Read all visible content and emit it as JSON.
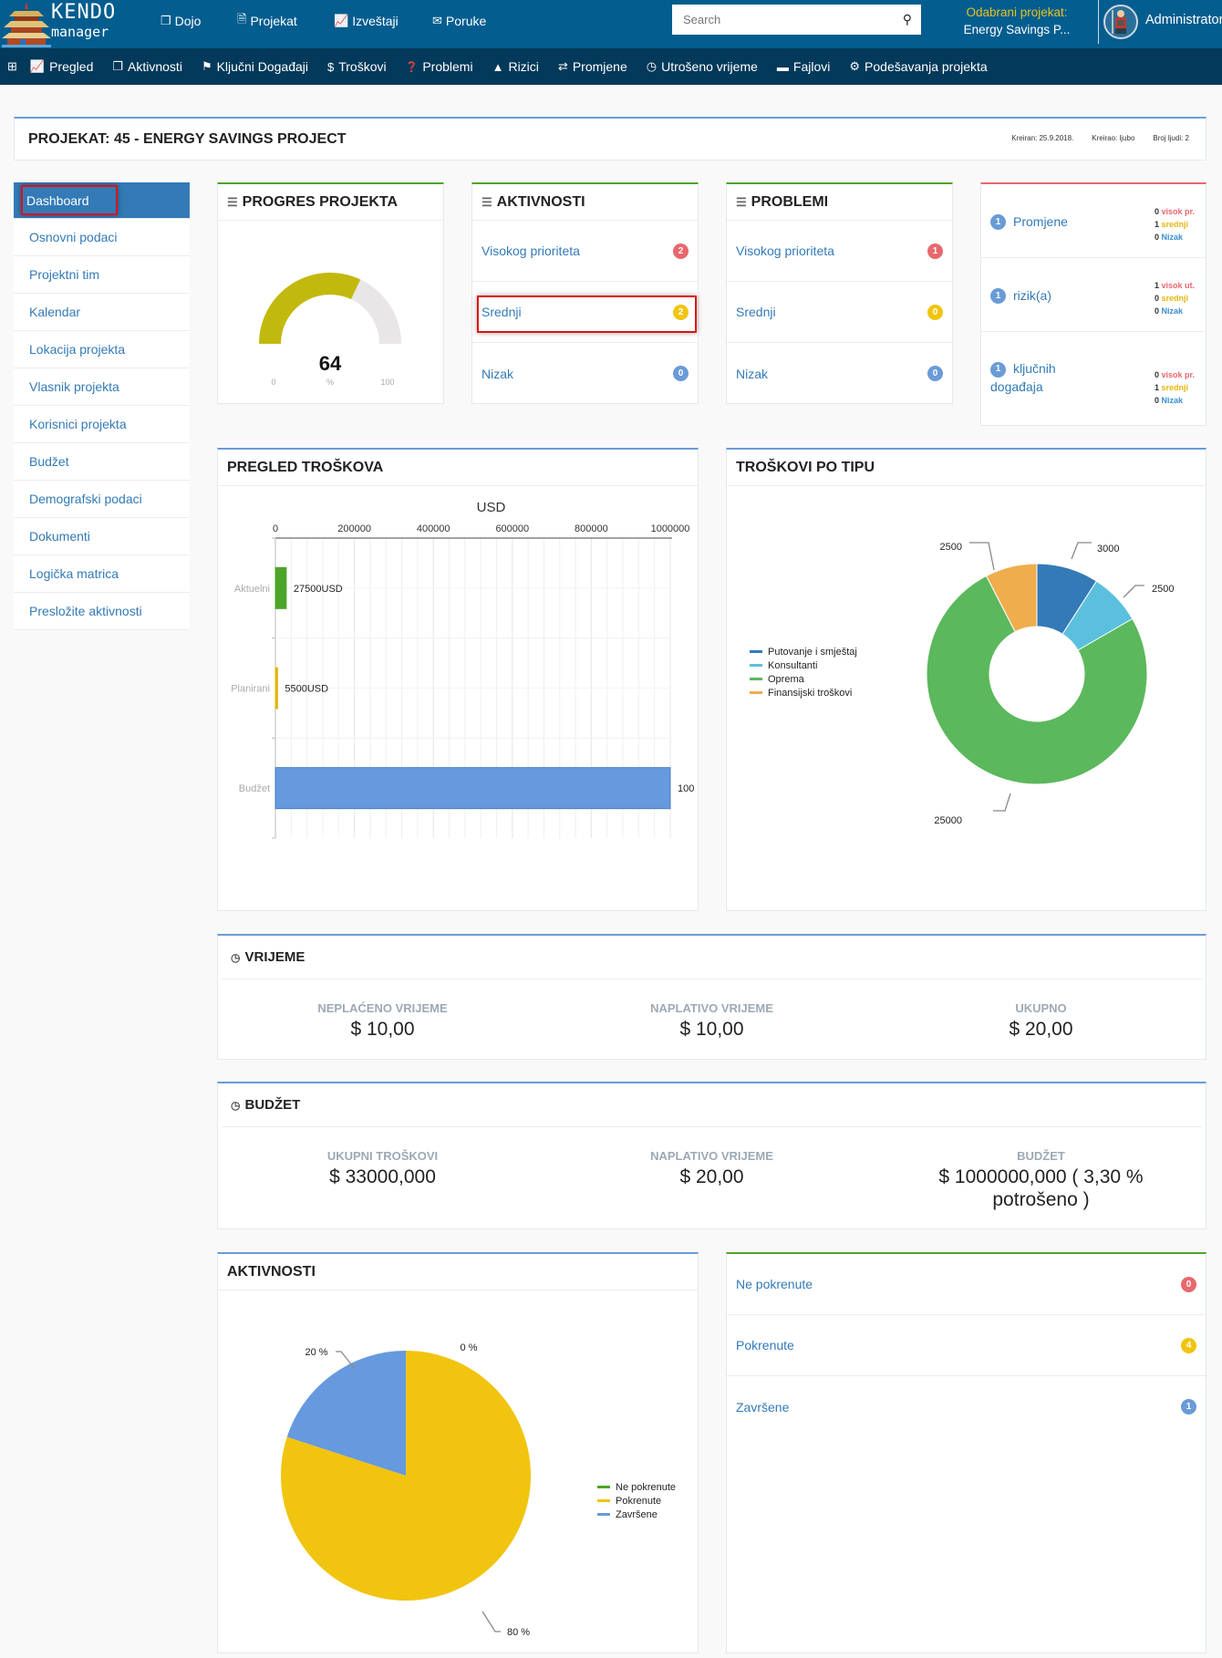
{
  "app": {
    "logo_top": "KENDO",
    "logo_bottom": "manager"
  },
  "topnav": [
    {
      "icon": "copy-icon",
      "glyph": "❐",
      "label": "Dojo"
    },
    {
      "icon": "file-icon",
      "glyph": "🗎",
      "label": "Projekat"
    },
    {
      "icon": "chart-line-icon",
      "glyph": "📈",
      "label": "Izveštaji"
    },
    {
      "icon": "envelope-icon",
      "glyph": "✉",
      "label": "Poruke"
    }
  ],
  "search": {
    "placeholder": "Search"
  },
  "selected_project": {
    "label": "Odabrani projekat:",
    "value": "Energy Savings P..."
  },
  "user": {
    "name": "Administrator"
  },
  "subnav": [
    {
      "icon": "plus-square-icon",
      "glyph": "⊞",
      "label": ""
    },
    {
      "icon": "chart-line-icon",
      "glyph": "📈",
      "label": "Pregled"
    },
    {
      "icon": "copy-icon",
      "glyph": "❐",
      "label": "Aktivnosti"
    },
    {
      "icon": "flag-icon",
      "glyph": "⚑",
      "label": "Ključni Događaji"
    },
    {
      "icon": "dollar-icon",
      "glyph": "$",
      "label": "Troškovi"
    },
    {
      "icon": "question-circle-icon",
      "glyph": "❓",
      "label": "Problemi"
    },
    {
      "icon": "warning-icon",
      "glyph": "▲",
      "label": "Rizici"
    },
    {
      "icon": "exchange-icon",
      "glyph": "⇄",
      "label": "Promjene"
    },
    {
      "icon": "clock-icon",
      "glyph": "◷",
      "label": "Utrošeno vrijeme"
    },
    {
      "icon": "folder-icon",
      "glyph": "▬",
      "label": "Fajlovi"
    },
    {
      "icon": "cogs-icon",
      "glyph": "⚙",
      "label": "Podešavanja projekta"
    }
  ],
  "project": {
    "title": "PROJEKAT: 45 - ENERGY SAVINGS PROJECT",
    "created": "Kreiran: 25.9.2018.",
    "created_by": "Kreirao: ljubo",
    "people": "Broj ljudi: 2"
  },
  "sidebar": [
    {
      "label": "Dashboard",
      "active": true
    },
    {
      "label": "Osnovni podaci"
    },
    {
      "label": "Projektni tim"
    },
    {
      "label": "Kalendar"
    },
    {
      "label": "Lokacija projekta"
    },
    {
      "label": "Vlasnik projekta"
    },
    {
      "label": "Korisnici projekta"
    },
    {
      "label": "Budžet"
    },
    {
      "label": "Demografski podaci"
    },
    {
      "label": "Dokumenti"
    },
    {
      "label": "Logička matrica"
    },
    {
      "label": "Presložite aktivnosti"
    }
  ],
  "progress": {
    "title": "PROGRES PROJEKTA",
    "value": 64,
    "min_label": "0",
    "unit_label": "%",
    "max_label": "100",
    "color": "#c2b90e"
  },
  "activities_card": {
    "title": "AKTIVNOSTI",
    "rows": [
      {
        "label": "Visokog prioriteta",
        "count": "2",
        "color": "red"
      },
      {
        "label": "Srednji",
        "count": "2",
        "color": "yellow"
      },
      {
        "label": "Nizak",
        "count": "0",
        "color": "blue"
      }
    ]
  },
  "problems_card": {
    "title": "PROBLEMI",
    "rows": [
      {
        "label": "Visokog prioriteta",
        "count": "1",
        "color": "red"
      },
      {
        "label": "Srednji",
        "count": "0",
        "color": "yellow"
      },
      {
        "label": "Nizak",
        "count": "0",
        "color": "blue"
      }
    ]
  },
  "summary_card": {
    "rows": [
      {
        "count": "1",
        "label": "Promjene",
        "label2": "",
        "c1": "0",
        "l1": "visok pr.",
        "c2": "1",
        "l2": "srednji",
        "c3": "0",
        "l3": "Nizak"
      },
      {
        "count": "1",
        "label": "rizik(a)",
        "label2": "",
        "c1": "1",
        "l1": "visok ut.",
        "c2": "0",
        "l2": "srednji",
        "c3": "0",
        "l3": "Nizak"
      },
      {
        "count": "1",
        "label": "ključnih",
        "label2": "događaja",
        "c1": "0",
        "l1": "visok pr.",
        "c2": "1",
        "l2": "srednji",
        "c3": "0",
        "l3": "Nizak"
      }
    ]
  },
  "chart_data": [
    {
      "type": "bar",
      "orientation": "horizontal",
      "title": "PREGLED TROŠKOVA",
      "axis_title": "USD",
      "categories": [
        "Aktuelni",
        "Planirani",
        "Budžet"
      ],
      "values": [
        27500,
        5500,
        1000000
      ],
      "data_labels": [
        "27500USD",
        "5500USD",
        "100"
      ],
      "colors": [
        "#4ca42a",
        "#e5b50f",
        "#6699dd"
      ],
      "xlim": [
        0,
        1000000
      ],
      "ticks": [
        "0",
        "200000",
        "400000",
        "600000",
        "800000",
        "1000000"
      ],
      "grid": true
    },
    {
      "type": "pie",
      "donut": true,
      "title": "TROŠKOVI PO TIPU",
      "legend": "left",
      "labels": [
        "Putovanje i smještaj",
        "Konsultanti",
        "Oprema",
        "Finansijski troškovi"
      ],
      "values": [
        3000,
        2500,
        25000,
        2500
      ],
      "colors": [
        "#337ab7",
        "#5bc0de",
        "#5cb85c",
        "#f0ad4e"
      ]
    },
    {
      "type": "pie",
      "title": "AKTIVNOSTI",
      "legend": "right",
      "labels": [
        "Ne pokrenute",
        "Pokrenute",
        "Završene"
      ],
      "values": [
        0,
        80,
        20
      ],
      "data_labels": [
        "0 %",
        "80 %",
        "20 %"
      ],
      "colors": [
        "#4ca42a",
        "#f1c40f",
        "#6699dd"
      ]
    }
  ],
  "time_card": {
    "title": "VRIJEME",
    "stats": [
      {
        "label": "NEPLAĆENO VRIJEME",
        "value": "$ 10,00"
      },
      {
        "label": "NAPLATIVO VRIJEME",
        "value": "$ 10,00"
      },
      {
        "label": "UKUPNO",
        "value": "$ 20,00"
      }
    ]
  },
  "budget_card": {
    "title": "BUDŽET",
    "stats": [
      {
        "label": "UKUPNI TROŠKOVI",
        "value": "$ 33000,000"
      },
      {
        "label": "NAPLATIVO VRIJEME",
        "value": "$ 20,00"
      },
      {
        "label": "BUDŽET",
        "value": "$ 1000000,000 ( 3,30 % potrošeno )"
      }
    ]
  },
  "activity_status": {
    "rows": [
      {
        "label": "Ne pokrenute",
        "count": "0",
        "color": "red"
      },
      {
        "label": "Pokrenute",
        "count": "4",
        "color": "yellow"
      },
      {
        "label": "Završene",
        "count": "1",
        "color": "blue"
      }
    ]
  }
}
